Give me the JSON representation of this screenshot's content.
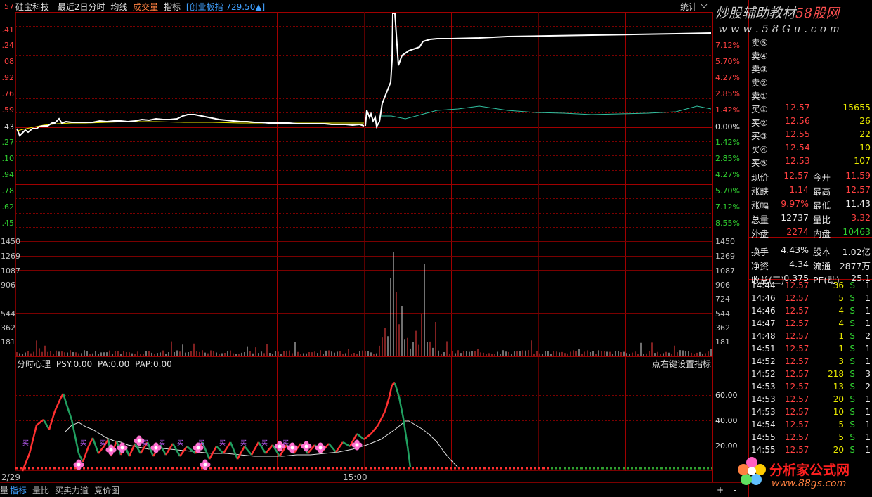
{
  "header": {
    "stock_name": "硅宝科技",
    "period": "最近2日分时",
    "avg_label": "均线",
    "vol_label": "成交量",
    "index_label": "指标",
    "market_index": "[创业板指 729.50▲]",
    "stats_label": "统计",
    "up_icon": "up-arrow-icon"
  },
  "price_axis": {
    "left": [
      "57",
      ".41",
      ".24",
      "08",
      ".92",
      ".76",
      ".59",
      "43",
      ".27",
      ".10",
      ".94",
      ".78",
      ".62",
      ".45"
    ],
    "right": [
      "7.12%",
      "5.70%",
      "4.27%",
      "2.85%",
      "1.42%",
      "0.00%",
      "1.42%",
      "2.85%",
      "4.27%",
      "5.70%",
      "7.12%",
      "8.55%"
    ]
  },
  "volume_axis": {
    "left": [
      "1450",
      "1269",
      "1087",
      "906",
      "544",
      "362",
      "181"
    ],
    "right": [
      "1450",
      "1269",
      "1087",
      "906",
      "724",
      "544",
      "362",
      "181"
    ]
  },
  "indicator": {
    "title": "分时心理",
    "psy": "PSY:0.00",
    "pa": "PA:0.00",
    "pap": "PAP:0.00",
    "hint": "点右键设置指标",
    "right_axis": [
      "60.00",
      "40.00",
      "20.00"
    ]
  },
  "x_axis": {
    "left_date": "2/29",
    "time_label": "15:00"
  },
  "bottom_tabs": [
    "量",
    "指标",
    "量比",
    "买卖力道",
    "竞价图"
  ],
  "bottom_right": {
    "plus": "+",
    "minus": "-"
  },
  "order_book": {
    "sells": [
      {
        "label": "卖⑤"
      },
      {
        "label": "卖④"
      },
      {
        "label": "卖③"
      },
      {
        "label": "卖②"
      },
      {
        "label": "卖①"
      }
    ],
    "buys": [
      {
        "label": "买①",
        "price": "12.57",
        "qty": "15655"
      },
      {
        "label": "买②",
        "price": "12.56",
        "qty": "26"
      },
      {
        "label": "买③",
        "price": "12.55",
        "qty": "22"
      },
      {
        "label": "买④",
        "price": "12.54",
        "qty": "10"
      },
      {
        "label": "买⑤",
        "price": "12.53",
        "qty": "107"
      }
    ]
  },
  "quote": [
    {
      "l1": "现价",
      "v1": "12.57",
      "l2": "今开",
      "v2": "11.59"
    },
    {
      "l1": "涨跌",
      "v1": "1.14",
      "l2": "最高",
      "v2": "12.57"
    },
    {
      "l1": "涨幅",
      "v1": "9.97%",
      "l2": "最低",
      "v2": "11.43"
    },
    {
      "l1": "总量",
      "v1": "12737",
      "l2": "量比",
      "v2": "3.32"
    },
    {
      "l1": "外盘",
      "v1": "2274",
      "l2": "内盘",
      "v2": "10463"
    },
    {
      "l1": "换手",
      "v1": "4.43%",
      "l2": "股本",
      "v2": "1.02亿"
    },
    {
      "l1": "净资",
      "v1": "4.34",
      "l2": "流通",
      "v2": "2877万"
    },
    {
      "l1": "收益(三)",
      "v1": "0.375",
      "l2": "PE(动)",
      "v2": "25.1"
    }
  ],
  "ticks": [
    {
      "time": "14:44",
      "price": "12.57",
      "qty": "36",
      "side": "S",
      "n": "1"
    },
    {
      "time": "14:46",
      "price": "12.57",
      "qty": "5",
      "side": "S",
      "n": "1"
    },
    {
      "time": "14:46",
      "price": "12.57",
      "qty": "4",
      "side": "S",
      "n": "1"
    },
    {
      "time": "14:47",
      "price": "12.57",
      "qty": "4",
      "side": "S",
      "n": "1"
    },
    {
      "time": "14:48",
      "price": "12.57",
      "qty": "1",
      "side": "S",
      "n": "2"
    },
    {
      "time": "14:51",
      "price": "12.57",
      "qty": "1",
      "side": "S",
      "n": "1"
    },
    {
      "time": "14:52",
      "price": "12.57",
      "qty": "3",
      "side": "S",
      "n": "1"
    },
    {
      "time": "14:52",
      "price": "12.57",
      "qty": "218",
      "side": "S",
      "n": "3"
    },
    {
      "time": "14:53",
      "price": "12.57",
      "qty": "13",
      "side": "S",
      "n": "2"
    },
    {
      "time": "14:53",
      "price": "12.57",
      "qty": "20",
      "side": "S",
      "n": "1"
    },
    {
      "time": "14:53",
      "price": "12.57",
      "qty": "10",
      "side": "S",
      "n": "1"
    },
    {
      "time": "14:54",
      "price": "12.57",
      "qty": "5",
      "side": "S",
      "n": "1"
    },
    {
      "time": "14:55",
      "price": "12.57",
      "qty": "5",
      "side": "S",
      "n": "1"
    },
    {
      "time": "14:55",
      "price": "12.57",
      "qty": "20",
      "side": "S",
      "n": "1"
    }
  ],
  "watermark_top": {
    "line1": "炒股辅助教材",
    "line1b": "58股网",
    "line2": "w w w . 5 8 G u . c o m"
  },
  "watermark_bottom": {
    "line1": "分析家公式网",
    "line2": "www.88gs.com"
  },
  "flower_label": "买",
  "colors": {
    "grid": "#7a0000",
    "up": "#ff4040",
    "down": "#30d030",
    "price_line": "#ffffff",
    "avg_line": "#e8e800"
  }
}
